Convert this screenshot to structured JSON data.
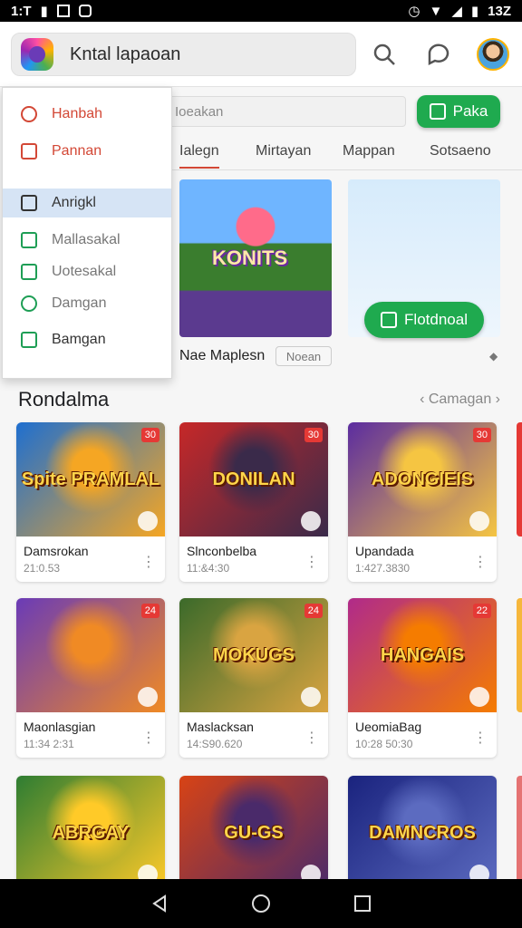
{
  "status_bar": {
    "time": "1:T",
    "battery": "13Z"
  },
  "header": {
    "title": "Kntal lapaoan"
  },
  "search": {
    "placeholder": "Ioeakan"
  },
  "primary_button": {
    "label": "Paka"
  },
  "tabs": [
    {
      "label": "Ialegn"
    },
    {
      "label": "Mirtayan"
    },
    {
      "label": "Mappan"
    },
    {
      "label": "Sotsaeno"
    }
  ],
  "featured": {
    "main_logo_text": "KONITS",
    "caption": "Nae Maplesn",
    "tag": "Noean",
    "right_button_label": "Flotdnoal"
  },
  "section": {
    "title": "Rondalma",
    "link": "Camagan"
  },
  "dropdown": [
    {
      "label": "Hanbah",
      "style": "red"
    },
    {
      "label": "Pannan",
      "style": "red"
    },
    {
      "label": "Anrigkl",
      "style": "normal"
    },
    {
      "label": "Mallasakal",
      "style": "green"
    },
    {
      "label": "Uotesakal",
      "style": "green"
    },
    {
      "label": "Damgan",
      "style": "green"
    },
    {
      "label": "Bamgan",
      "style": "green"
    }
  ],
  "games": [
    {
      "title": "Damsrokan",
      "meta": "21:0.53",
      "badge": "30",
      "art": "Spite PRAMLAL",
      "colors": [
        "#1e6fd0",
        "#f5a623"
      ]
    },
    {
      "title": "Slnconbelba",
      "meta": "11:&4:30",
      "badge": "30",
      "art": "DONILAN",
      "colors": [
        "#c62828",
        "#3a2a4a"
      ]
    },
    {
      "title": "Upandada",
      "meta": "1:427.3830",
      "badge": "30",
      "art": "ADONGIEIS",
      "colors": [
        "#5b2ca0",
        "#f5c542"
      ]
    },
    {
      "title": "Maonlasgian",
      "meta": "11:34 2:31",
      "badge": "24",
      "art": "",
      "colors": [
        "#6a3bb7",
        "#f08a24"
      ]
    },
    {
      "title": "Maslacksan",
      "meta": "14:S90.620",
      "badge": "24",
      "art": "MOKUGS",
      "colors": [
        "#3b6a2a",
        "#d9a441"
      ]
    },
    {
      "title": "UeomiaBag",
      "meta": "10:28 50:30",
      "badge": "22",
      "art": "HANGAIS",
      "colors": [
        "#b02a8a",
        "#f57c00"
      ]
    },
    {
      "title": "",
      "meta": "",
      "badge": "",
      "art": "ABRGAY",
      "colors": [
        "#2e7d32",
        "#ffca28"
      ]
    },
    {
      "title": "",
      "meta": "",
      "badge": "",
      "art": "GU-GS",
      "colors": [
        "#d84315",
        "#4a2a6a"
      ]
    },
    {
      "title": "",
      "meta": "",
      "badge": "",
      "art": "DAMNCROS",
      "colors": [
        "#1a237e",
        "#5c6bc0"
      ]
    }
  ],
  "colors": {
    "accent_green": "#1faa4f",
    "accent_red": "#d34836",
    "highlight": "#d6e4f5"
  }
}
